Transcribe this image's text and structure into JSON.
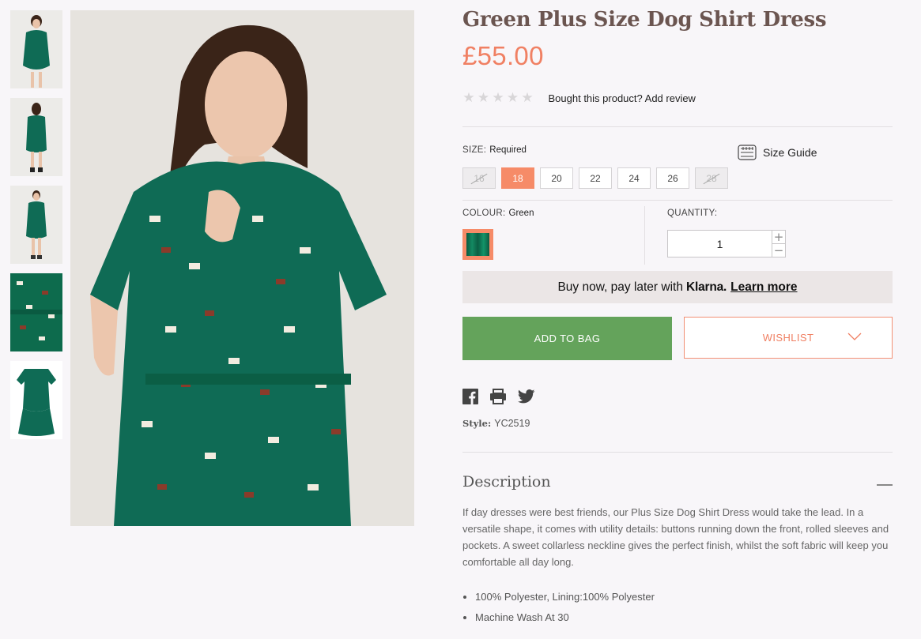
{
  "thumbnails": [
    {
      "name": "thumb-front"
    },
    {
      "name": "thumb-back"
    },
    {
      "name": "thumb-full"
    },
    {
      "name": "thumb-fabric"
    },
    {
      "name": "thumb-flat"
    }
  ],
  "product": {
    "title": "Green Plus Size Dog Shirt Dress",
    "price": "£55.00",
    "rating_stars": 0,
    "review_link": "Bought this product? Add review",
    "style_label": "Style:",
    "style_code": "YC2519"
  },
  "size": {
    "label": "SIZE:",
    "required": "Required",
    "guide_label": "Size Guide",
    "options": [
      {
        "label": "16",
        "state": "disabled"
      },
      {
        "label": "18",
        "state": "selected"
      },
      {
        "label": "20",
        "state": "available"
      },
      {
        "label": "22",
        "state": "available"
      },
      {
        "label": "24",
        "state": "available"
      },
      {
        "label": "26",
        "state": "available"
      },
      {
        "label": "28",
        "state": "disabled"
      }
    ]
  },
  "colour": {
    "label": "COLOUR:",
    "value": "Green"
  },
  "quantity": {
    "label": "QUANTITY:",
    "value": "1",
    "plus": "+",
    "minus": "−"
  },
  "klarna": {
    "text": "Buy now, pay later with",
    "brand": "Klarna.",
    "link": "Learn more"
  },
  "actions": {
    "add_to_bag": "ADD TO BAG",
    "wishlist": "WISHLIST"
  },
  "description": {
    "title": "Description",
    "body": "If day dresses were best friends, our Plus Size Dog Shirt Dress would take the lead. In a versatile shape, it comes with utility details: buttons running down the front, rolled sleeves and pockets. A sweet collarless neckline gives the perfect finish, whilst the soft fabric will keep you comfortable all day long.",
    "bullets": [
      "100% Polyester, Lining:100% Polyester",
      "Machine Wash At 30"
    ]
  },
  "colors": {
    "accent": "#f68b68",
    "price": "#f08063",
    "add_to_bag": "#64a35b",
    "dress": "#0f6b55"
  }
}
